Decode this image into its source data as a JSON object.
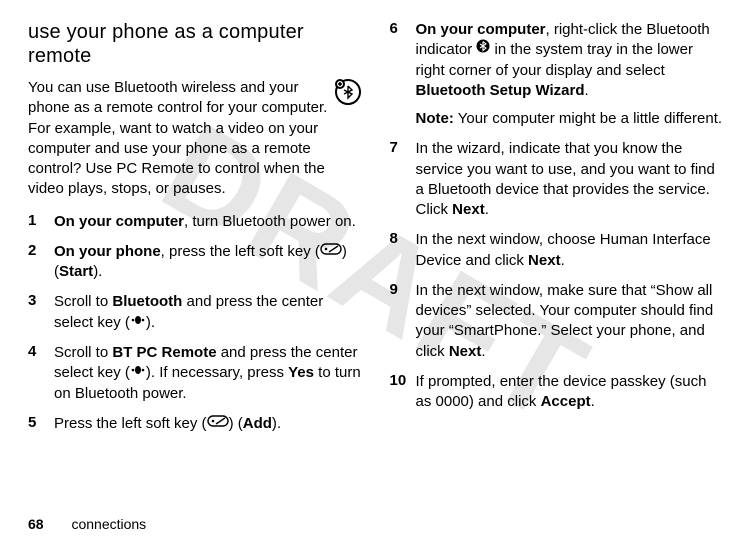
{
  "watermark": "DRAFT",
  "heading": "use your phone as a computer remote",
  "intro": "You can use Bluetooth wireless and your phone as a remote control for your computer. For example, want to watch a video on your computer and use your phone as a remote control? Use PC Remote to control when the video plays, stops, or pauses.",
  "steps": [
    {
      "num": "1",
      "parts": [
        {
          "t": "On your computer",
          "cls": "bold"
        },
        {
          "t": ", turn Bluetooth power on."
        }
      ]
    },
    {
      "num": "2",
      "parts": [
        {
          "t": "On your phone",
          "cls": "bold"
        },
        {
          "t": ", press the left soft key ("
        },
        {
          "icon": "softkey"
        },
        {
          "t": ") ("
        },
        {
          "t": "Start",
          "cls": "cond"
        },
        {
          "t": ")."
        }
      ]
    },
    {
      "num": "3",
      "parts": [
        {
          "t": "Scroll to "
        },
        {
          "t": "Bluetooth",
          "cls": "cond"
        },
        {
          "t": " and press the center select key ("
        },
        {
          "icon": "center"
        },
        {
          "t": ")."
        }
      ]
    },
    {
      "num": "4",
      "parts": [
        {
          "t": "Scroll to "
        },
        {
          "t": "BT PC Remote",
          "cls": "cond"
        },
        {
          "t": " and press the center select key ("
        },
        {
          "icon": "center"
        },
        {
          "t": "). If necessary, press "
        },
        {
          "t": "Yes",
          "cls": "cond"
        },
        {
          "t": " to turn on Bluetooth power."
        }
      ]
    },
    {
      "num": "5",
      "parts": [
        {
          "t": "Press the left soft key ("
        },
        {
          "icon": "softkey"
        },
        {
          "t": ") ("
        },
        {
          "t": "Add",
          "cls": "cond"
        },
        {
          "t": ")."
        }
      ]
    },
    {
      "num": "6",
      "parts": [
        {
          "t": "On your computer",
          "cls": "bold"
        },
        {
          "t": ", right-click the Bluetooth indicator "
        },
        {
          "icon": "btround"
        },
        {
          "t": " in the system tray in the lower right corner of your display and select "
        },
        {
          "t": "Bluetooth Setup Wizard",
          "cls": "bold"
        },
        {
          "t": "."
        }
      ],
      "note": [
        {
          "t": "Note:",
          "cls": "bold"
        },
        {
          "t": " Your computer might be a little different."
        }
      ]
    },
    {
      "num": "7",
      "parts": [
        {
          "t": "In the wizard, indicate that you know the service you want to use, and you want to find a Bluetooth device that provides the service. Click "
        },
        {
          "t": "Next",
          "cls": "bold"
        },
        {
          "t": "."
        }
      ]
    },
    {
      "num": "8",
      "parts": [
        {
          "t": "In the next window, choose Human Interface Device and click "
        },
        {
          "t": "Next",
          "cls": "bold"
        },
        {
          "t": "."
        }
      ]
    },
    {
      "num": "9",
      "parts": [
        {
          "t": "In the next window, make sure that “Show all devices” selected. Your computer should find your “SmartPhone.” Select your phone, and click "
        },
        {
          "t": "Next",
          "cls": "bold"
        },
        {
          "t": "."
        }
      ]
    },
    {
      "num": "10",
      "parts": [
        {
          "t": "If prompted, enter the device passkey (such as 0000) and click "
        },
        {
          "t": "Accept",
          "cls": "bold"
        },
        {
          "t": "."
        }
      ]
    }
  ],
  "footer": {
    "page": "68",
    "section": "connections"
  }
}
